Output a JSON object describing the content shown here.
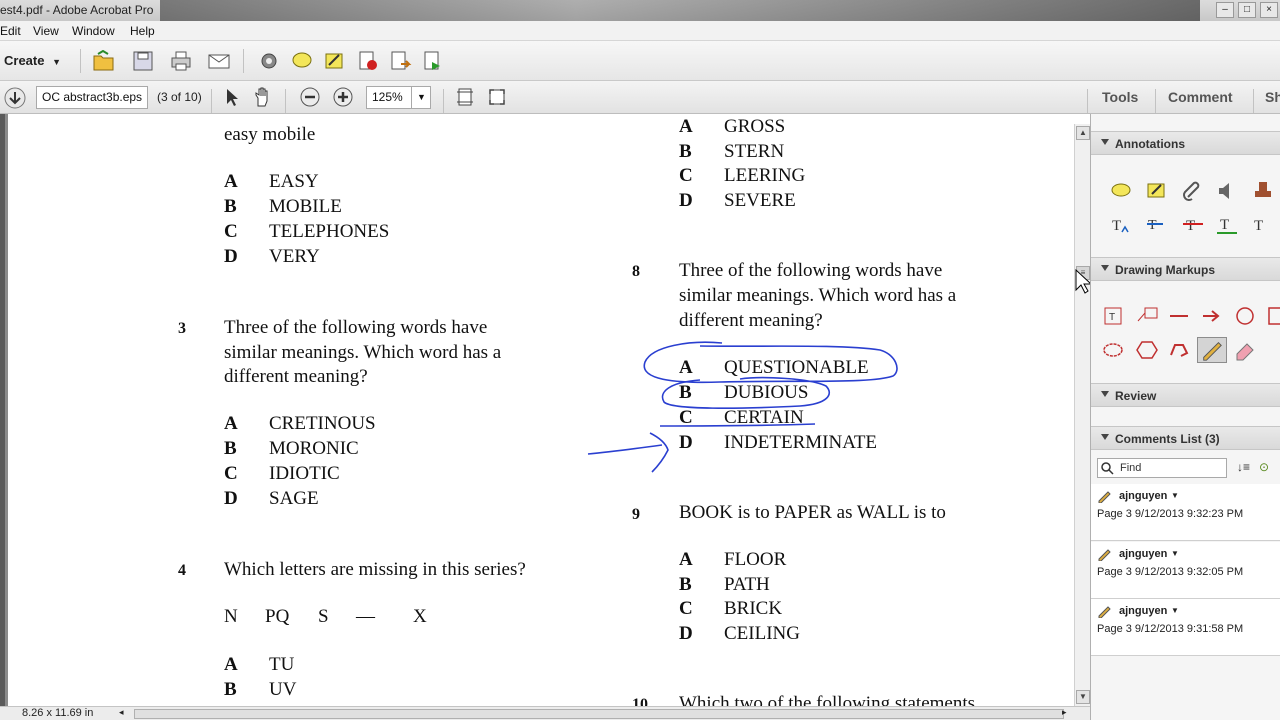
{
  "window": {
    "title": "est4.pdf - Adobe Acrobat Pro"
  },
  "menu": {
    "items": [
      "Edit",
      "View",
      "Window",
      "Help"
    ]
  },
  "toolbar": {
    "create_label": "Create",
    "file_field": "OC abstract3b.eps",
    "page_info": "(3 of 10)",
    "zoom": "125%",
    "tabs": [
      "Tools",
      "Comment",
      "Sh"
    ]
  },
  "document": {
    "fragment_top": "easy mobile",
    "q2_options": [
      {
        "letter": "A",
        "text": "EASY"
      },
      {
        "letter": "B",
        "text": "MOBILE"
      },
      {
        "letter": "C",
        "text": "TELEPHONES"
      },
      {
        "letter": "D",
        "text": "VERY"
      }
    ],
    "q3": {
      "num": "3",
      "lines": [
        "Three of the following words have",
        "similar meanings. Which word has a",
        "different meaning?"
      ],
      "options": [
        {
          "letter": "A",
          "text": "CRETINOUS"
        },
        {
          "letter": "B",
          "text": "MORONIC"
        },
        {
          "letter": "C",
          "text": "IDIOTIC"
        },
        {
          "letter": "D",
          "text": "SAGE"
        }
      ]
    },
    "q4": {
      "num": "4",
      "text": "Which letters are missing in this series?",
      "series": [
        "N",
        "PQ",
        "S",
        "—",
        "X"
      ],
      "options": [
        {
          "letter": "A",
          "text": "TU"
        },
        {
          "letter": "B",
          "text": "UV"
        }
      ]
    },
    "q7_options": [
      {
        "letter": "A",
        "text": "GROSS"
      },
      {
        "letter": "B",
        "text": "STERN"
      },
      {
        "letter": "C",
        "text": "LEERING"
      },
      {
        "letter": "D",
        "text": "SEVERE"
      }
    ],
    "q8": {
      "num": "8",
      "lines": [
        "Three of the following words have",
        "similar meanings. Which word has a",
        "different meaning?"
      ],
      "options": [
        {
          "letter": "A",
          "text": "QUESTIONABLE"
        },
        {
          "letter": "B",
          "text": "DUBIOUS"
        },
        {
          "letter": "C",
          "text": "CERTAIN"
        },
        {
          "letter": "D",
          "text": "INDETERMINATE"
        }
      ]
    },
    "q9": {
      "num": "9",
      "text": "BOOK is to PAPER as WALL is to",
      "options": [
        {
          "letter": "A",
          "text": "FLOOR"
        },
        {
          "letter": "B",
          "text": "PATH"
        },
        {
          "letter": "C",
          "text": "BRICK"
        },
        {
          "letter": "D",
          "text": "CEILING"
        }
      ]
    },
    "q10": {
      "num": "10",
      "text": "Which two of the following statements"
    },
    "annotation_color": "#2a3fd0"
  },
  "status": {
    "page_size": "8.26 x 11.69 in"
  },
  "panel": {
    "annotations": "Annotations",
    "drawing": "Drawing Markups",
    "review": "Review",
    "comments_list": "Comments List (3)",
    "find_placeholder": "Find",
    "comments": [
      {
        "author": "ajnguyen",
        "meta": "Page 3  9/12/2013 9:32:23 PM"
      },
      {
        "author": "ajnguyen",
        "meta": "Page 3  9/12/2013 9:32:05 PM"
      },
      {
        "author": "ajnguyen",
        "meta": "Page 3  9/12/2013 9:31:58 PM"
      }
    ]
  }
}
